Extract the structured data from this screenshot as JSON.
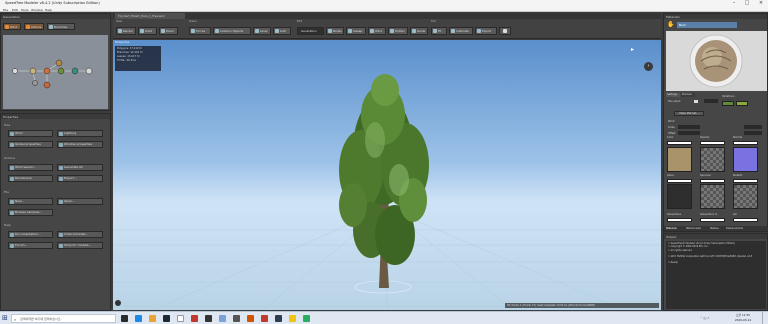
{
  "window": {
    "title": "SpeedTree Modeler v8.4.2 (Unity Subscription Edition)"
  },
  "menu": [
    "File",
    "Edit",
    "Tools",
    "Window",
    "Help"
  ],
  "generation": {
    "title": "Generation",
    "tabs": [
      {
        "label": "Wind"
      },
      {
        "label": "Actions"
      },
      {
        "label": "Branches"
      }
    ]
  },
  "properties": {
    "title": "Properties",
    "sections": [
      {
        "name": "Tree",
        "buttons": [
          {
            "label": "Wind"
          },
          {
            "label": "Lighting"
          },
          {
            "label": "Global properties"
          },
          {
            "label": "Window properties"
          }
        ]
      },
      {
        "name": "Actions",
        "buttons": [
          {
            "label": "Wind search..."
          },
          {
            "label": "Generate All"
          },
          {
            "label": "Randomize"
          },
          {
            "label": "Export..."
          }
        ]
      },
      {
        "name": "File",
        "buttons": [
          {
            "label": "New..."
          },
          {
            "label": "Open..."
          },
          {
            "label": "Browse samples..."
          }
        ]
      },
      {
        "name": "Help",
        "buttons": [
          {
            "label": "Documentation..."
          },
          {
            "label": "Video tutorials..."
          },
          {
            "label": "Forum..."
          },
          {
            "label": "Shop for models..."
          }
        ]
      }
    ]
  },
  "document": {
    "tab": "Tinyhart_Hibert_Hero_1_Tree.spm"
  },
  "toolbar": {
    "groups": [
      {
        "name": "View",
        "buttons": [
          {
            "label": "Render"
          },
          {
            "label": "Orbit"
          },
          {
            "label": "Zoom"
          }
        ]
      },
      {
        "name": "Scene",
        "buttons": [
          {
            "label": "Forces"
          },
          {
            "label": "Collision Objects"
          },
          {
            "label": "Level"
          },
          {
            "label": "LOD"
          }
        ]
      },
      {
        "name": "Edit",
        "buttons": [
          {
            "label": "Generation"
          },
          {
            "label": "Nodes"
          },
          {
            "label": "Sweep"
          },
          {
            "label": "Wind"
          },
          {
            "label": "Hidden"
          },
          {
            "label": "Guide"
          }
        ]
      },
      {
        "name": "Tool",
        "buttons": [
          {
            "label": "Fit"
          },
          {
            "label": "Calibrate"
          },
          {
            "label": "Export"
          }
        ]
      }
    ]
  },
  "viewport": {
    "label": "Perspective",
    "stats": [
      {
        "k": "Polygons:",
        "v": "27,419 tri"
      },
      {
        "k": "Branches:",
        "v": "12,402 tri"
      },
      {
        "k": "Leaves:",
        "v": "15,017 tri"
      },
      {
        "k": "TOTAL:",
        "v": "46.3ms"
      }
    ],
    "status": "Tot: fronds: 1 | Fronds: 73 | mesh Composite: 70.30 ms | Wind at 0.0 ms (NORM)"
  },
  "materials": {
    "title": "Materials",
    "search": "Bark",
    "tabs": [
      {
        "label": "Settings"
      },
      {
        "label": "Preview"
      }
    ],
    "fields": [
      {
        "label": "Two-sided"
      },
      {
        "label": "Variations"
      },
      {
        "label": "Wind"
      },
      {
        "label": "Scale"
      },
      {
        "label": "Offset"
      }
    ],
    "bake_label": "Make Mat Set...",
    "maps": [
      {
        "label": "Color"
      },
      {
        "label": "Opacity"
      },
      {
        "label": "Normal"
      },
      {
        "label": "Gloss"
      },
      {
        "label": "Specular"
      },
      {
        "label": "Metallic"
      },
      {
        "label": "Subsurface"
      },
      {
        "label": "Subsurface %"
      },
      {
        "label": "AO"
      }
    ],
    "bottom_tabs": [
      {
        "label": "Materials"
      },
      {
        "label": "Material sets"
      },
      {
        "label": "Meshes"
      },
      {
        "label": "Displacements"
      }
    ]
  },
  "output": {
    "title": "Output",
    "lines": [
      "> SpeedTree® Modeler v8.4.2 (Unity Subscription Edition)",
      "> Copyright © 2002-2019 IDV, Inc.",
      "> All rights reserved.",
      "",
      "> GPU: NVIDIA Corporation GeForce GTX 1050Ti/PCIe/SSE2, OpenGL v4.5",
      "",
      "> Ready"
    ]
  },
  "taskbar": {
    "search_placeholder": "검색하려면 여기에 입력하십시오.",
    "time": "오전 11:55",
    "date": "2020-03-14"
  },
  "colors": {
    "sky_top": "#5a8fcc",
    "sky_bottom": "#cfe3f6",
    "ground": "#b9d3e6",
    "panel": "#464646",
    "accent": "#4a90d9"
  }
}
